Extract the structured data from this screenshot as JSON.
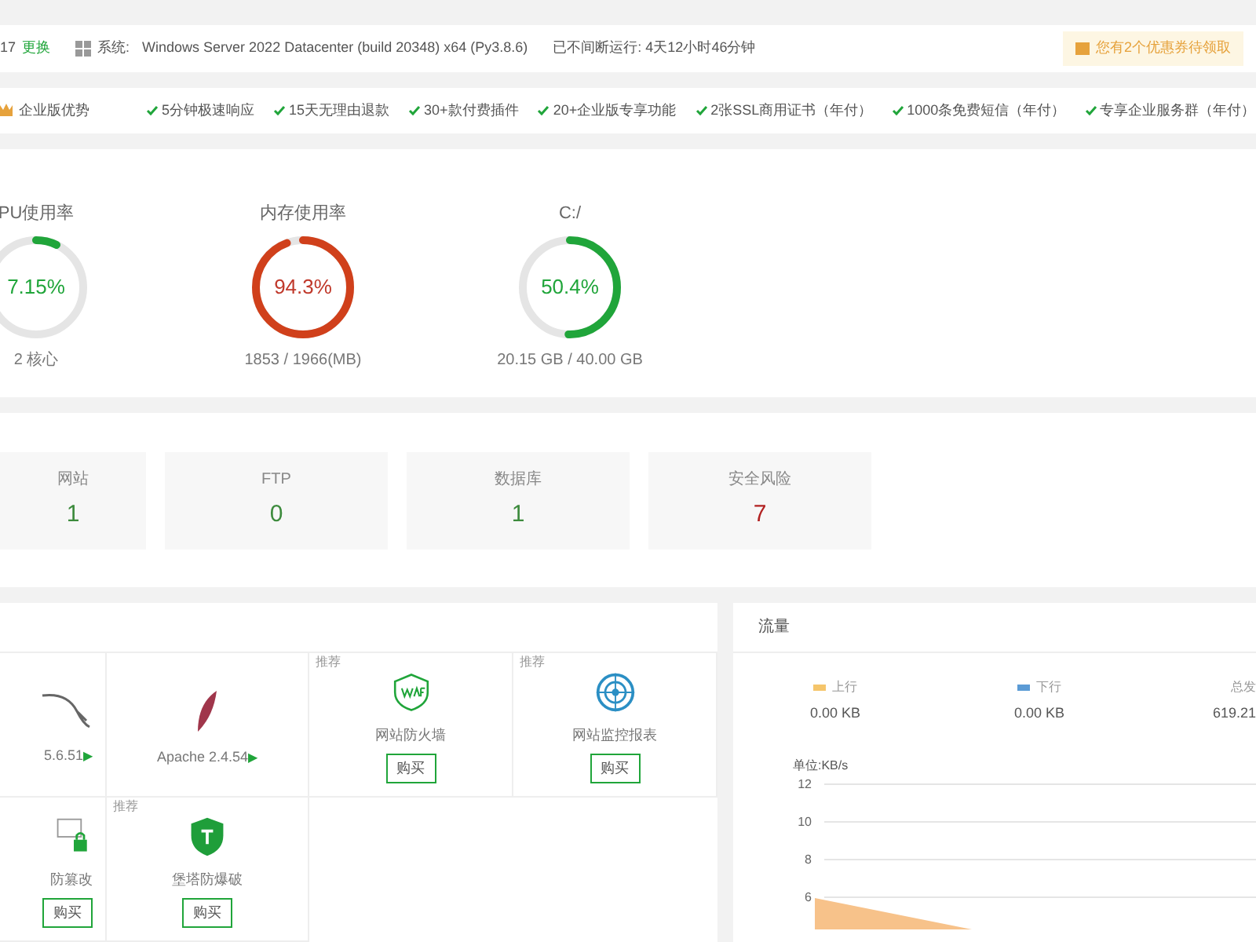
{
  "top_bar": {
    "version": "17",
    "switch_link": "更换",
    "system_label": "系统:",
    "system_value": "Windows Server 2022 Datacenter (build 20348) x64 (Py3.8.6)",
    "uptime": "已不间断运行: 4天12小时46分钟",
    "coupon": "您有2个优惠券待领取"
  },
  "enterprise": {
    "title": "企业版优势",
    "items": [
      "5分钟极速响应",
      "15天无理由退款",
      "30+款付费插件",
      "20+企业版专享功能",
      "2张SSL商用证书（年付）",
      "1000条免费短信（年付）",
      "专享企业服务群（年付）"
    ]
  },
  "gauges": [
    {
      "title": "PU使用率",
      "value": "7.15%",
      "detail": "2 核心",
      "level": 0.0715
    },
    {
      "title": "内存使用率",
      "value": "94.3%",
      "detail": "1853 / 1966(MB)",
      "level": 0.943
    },
    {
      "title": "C:/",
      "value": "50.4%",
      "detail": "20.15 GB / 40.00 GB",
      "level": 0.504
    }
  ],
  "stats": [
    {
      "label": "网站",
      "value": "1",
      "kind": "normal"
    },
    {
      "label": "FTP",
      "value": "0",
      "kind": "normal"
    },
    {
      "label": "数据库",
      "value": "1",
      "kind": "normal"
    },
    {
      "label": "安全风险",
      "value": "7",
      "kind": "danger"
    }
  ],
  "software": [
    {
      "kind": "mysql",
      "name": "5.6.51",
      "arrow": "▶"
    },
    {
      "kind": "apache",
      "name": "Apache 2.4.54",
      "arrow": "▶"
    },
    {
      "kind": "waf",
      "tag": "推荐",
      "name": "网站防火墙",
      "button": "购买"
    },
    {
      "kind": "monitor",
      "tag": "推荐",
      "name": "网站监控报表",
      "button": "购买"
    },
    {
      "kind": "tamper",
      "name": "防篡改",
      "button": "购买"
    },
    {
      "kind": "bruteforce",
      "tag": "推荐",
      "name": "堡塔防爆破",
      "button": "购买"
    }
  ],
  "traffic": {
    "title": "流量",
    "legend": [
      {
        "label": "上行",
        "value": "0.00 KB",
        "color": "#f5c56b"
      },
      {
        "label": "下行",
        "value": "0.00 KB",
        "color": "#5b9bd5"
      }
    ],
    "total_label": "总发",
    "total_value": "619.21",
    "y_axis": {
      "label": "单位:KB/s",
      "ticks": [
        "12",
        "10",
        "8",
        "6"
      ]
    }
  }
}
